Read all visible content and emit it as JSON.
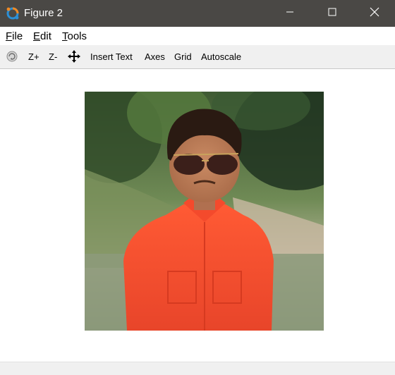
{
  "window": {
    "title": "Figure 2",
    "icon": "octave-logo-icon",
    "controls": [
      "minimize-icon",
      "maximize-icon",
      "close-icon"
    ]
  },
  "menu": {
    "file": {
      "accel": "F",
      "rest": "ile"
    },
    "edit": {
      "accel": "E",
      "rest": "dit"
    },
    "tools": {
      "accel": "T",
      "rest": "ools"
    }
  },
  "toolbar": {
    "rotate_icon": "rotate-3d-icon",
    "zoom_in": "Z+",
    "zoom_out": "Z-",
    "pan_icon": "pan-move-icon",
    "insert_text": "Insert Text",
    "axes": "Axes",
    "grid": "Grid",
    "autoscale": "Autoscale"
  },
  "figure": {
    "content": "photograph-image",
    "colors": {
      "shirt": "#f2532f",
      "background_foliage": "#4b6b3a",
      "water": "#8a987a"
    }
  }
}
